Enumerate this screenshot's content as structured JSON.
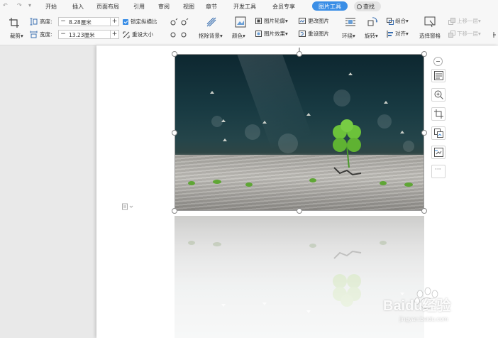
{
  "tabs": {
    "items": [
      "开始",
      "插入",
      "页面布局",
      "引用",
      "审阅",
      "视图",
      "章节",
      "开发工具",
      "会员专享",
      "图片工具"
    ],
    "active": "图片工具",
    "search": "查找"
  },
  "ribbon": {
    "crop_label": "裁剪",
    "height_label": "高度:",
    "height_value": "8.28厘米",
    "width_label": "宽度:",
    "width_value": "13.23厘米",
    "lock_ratio": "锁定纵横比",
    "reset_size": "重设大小",
    "remove_bg": "抠除背景",
    "color": "颜色",
    "outline": "图片轮廓",
    "effects": "图片效果",
    "change_picture": "更改图片",
    "reset_picture": "重设图片",
    "wrap": "环绕",
    "rotate": "旋转",
    "combine": "组合",
    "align": "对齐",
    "selection_pane": "选择窗格",
    "bring_forward": "上移一层",
    "send_backward": "下移一层",
    "minus": "−",
    "plus": "+"
  },
  "side_tools": [
    "layout-options-icon",
    "zoom-icon",
    "crop-tool-icon",
    "replace-image-icon",
    "image-compress-icon",
    "more-icon"
  ],
  "more_label": "···",
  "watermark": {
    "brand": "Baidu经验",
    "url": "jingyan.baidu.com"
  },
  "colors": {
    "accent": "#3a8ee6",
    "clover": "#6cc23a"
  }
}
